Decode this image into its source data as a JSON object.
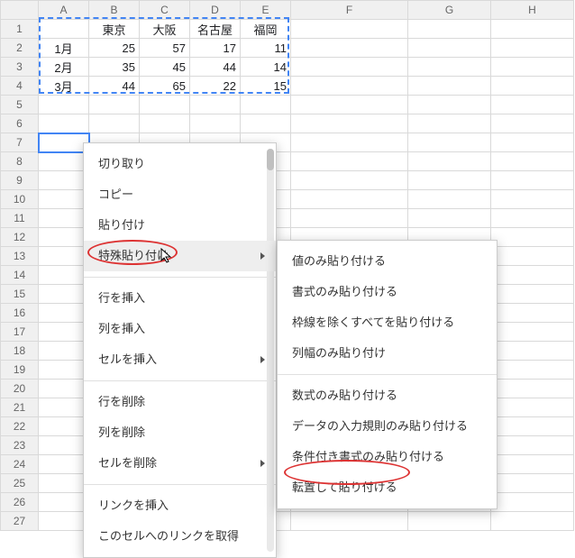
{
  "columns": [
    "A",
    "B",
    "C",
    "D",
    "E",
    "F",
    "G",
    "H"
  ],
  "rows": [
    "1",
    "2",
    "3",
    "4",
    "5",
    "6",
    "7",
    "8",
    "9",
    "10",
    "11",
    "12",
    "13",
    "14",
    "15",
    "16",
    "17",
    "18",
    "19",
    "20",
    "21",
    "22",
    "23",
    "24",
    "25",
    "26",
    "27"
  ],
  "grid": {
    "header_row": [
      "",
      "東京",
      "大阪",
      "名古屋",
      "福岡"
    ],
    "data_rows": [
      [
        "1月",
        "25",
        "57",
        "17",
        "11"
      ],
      [
        "2月",
        "35",
        "45",
        "44",
        "14"
      ],
      [
        "3月",
        "44",
        "65",
        "22",
        "15"
      ]
    ]
  },
  "marquee": {
    "top_row": 1,
    "left_col": 1,
    "rows": 4,
    "cols": 5
  },
  "active_cell": {
    "row": 7,
    "col": "A"
  },
  "context_menu": {
    "items": [
      {
        "label": "切り取り"
      },
      {
        "label": "コピー"
      },
      {
        "label": "貼り付け"
      },
      {
        "label": "特殊貼り付け",
        "sub": true,
        "hover": true,
        "anno": true
      },
      {
        "sep": true
      },
      {
        "label": "行を挿入"
      },
      {
        "label": "列を挿入"
      },
      {
        "label": "セルを挿入",
        "sub": true
      },
      {
        "sep": true
      },
      {
        "label": "行を削除"
      },
      {
        "label": "列を削除"
      },
      {
        "label": "セルを削除",
        "sub": true
      },
      {
        "sep": true
      },
      {
        "label": "リンクを挿入"
      },
      {
        "label": "このセルへのリンクを取得"
      }
    ]
  },
  "submenu": {
    "items": [
      {
        "label": "値のみ貼り付ける"
      },
      {
        "label": "書式のみ貼り付ける"
      },
      {
        "label": "枠線を除くすべてを貼り付ける"
      },
      {
        "label": "列幅のみ貼り付け"
      },
      {
        "sep": true
      },
      {
        "label": "数式のみ貼り付ける"
      },
      {
        "label": "データの入力規則のみ貼り付ける"
      },
      {
        "label": "条件付き書式のみ貼り付ける"
      },
      {
        "label": "転置して貼り付ける",
        "anno": true
      }
    ]
  },
  "chart_data": {
    "type": "table",
    "categories": [
      "東京",
      "大阪",
      "名古屋",
      "福岡"
    ],
    "series": [
      {
        "name": "1月",
        "values": [
          25,
          57,
          17,
          11
        ]
      },
      {
        "name": "2月",
        "values": [
          35,
          45,
          44,
          14
        ]
      },
      {
        "name": "3月",
        "values": [
          44,
          65,
          22,
          15
        ]
      }
    ],
    "title": "",
    "xlabel": "",
    "ylabel": ""
  }
}
